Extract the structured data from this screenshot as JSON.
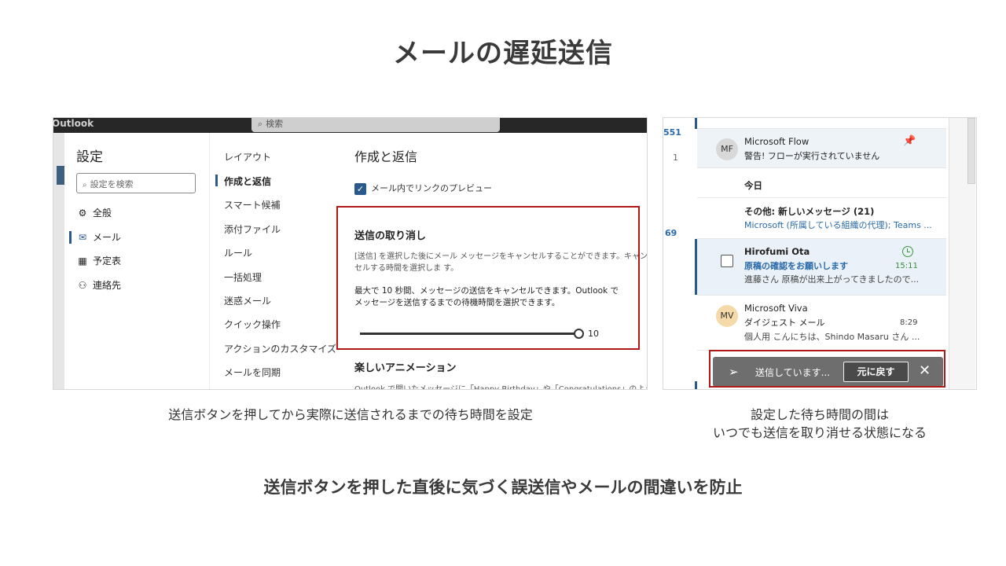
{
  "slide": {
    "title": "メールの遅延送信",
    "caption_left": "送信ボタンを押してから実際に送信されるまでの待ち時間を設定",
    "caption_right_line1": "設定した待ち時間の間は",
    "caption_right_line2": "いつでも送信を取り消せる状態になる",
    "bottom_message": "送信ボタンを押した直後に気づく誤送信やメールの間違いを防止"
  },
  "colors": {
    "accent": "#2a5a8c",
    "highlight": "#b01818",
    "topbar": "#272727"
  },
  "outlook_settings": {
    "app_name": "Outlook",
    "search_placeholder": "検索",
    "settings_title": "設定",
    "settings_search": "設定を検索",
    "nav": [
      {
        "label": "全般",
        "icon": "gear-icon"
      },
      {
        "label": "メール",
        "icon": "mail-icon"
      },
      {
        "label": "予定表",
        "icon": "calendar-icon"
      },
      {
        "label": "連絡先",
        "icon": "people-icon"
      }
    ],
    "subnav": [
      "レイアウト",
      "作成と返信",
      "スマート候補",
      "添付ファイル",
      "ルール",
      "一括処理",
      "迷惑メール",
      "クイック操作",
      "アクションのカスタマイズ",
      "メールを同期"
    ],
    "content_title": "作成と返信",
    "link_preview_label": "メール内でリンクのプレビュー",
    "undo_send_title": "送信の取り消し",
    "undo_send_desc": "[送信] を選択した後にメール メッセージをキャンセルすることができます。キャンセルする時間を選択しま す。",
    "undo_send_detail": "最大で 10 秒間、メッセージの送信をキャンセルできます。Outlook でメッセージを送信するまでの待機時間を選択できます。",
    "slider_value": "10",
    "slider_fraction": 1.0,
    "animation_title": "楽しいアニメーション",
    "animation_desc": "Outlook で開いたメッセージに「Happy Birthday」や「Congratulations」のような"
  },
  "mail_list": {
    "counts": [
      "551",
      "1",
      "69"
    ],
    "rows": [
      {
        "avatar": "MF",
        "sender": "Microsoft Flow",
        "subject": "警告! フローが実行されていません"
      },
      {
        "label": "今日"
      },
      {
        "sender": "その他: 新しいメッセージ (21)",
        "preview": "Microsoft (所属している組織の代理); Teams ..."
      },
      {
        "sender": "Hirofumi Ota",
        "subject": "原稿の確認をお願いします",
        "time": "15:11",
        "preview": "進藤さん 原稿が出来上がってきましたので..."
      },
      {
        "avatar": "MV",
        "sender": "Microsoft Viva",
        "subject": "ダイジェスト メール",
        "time": "8:29",
        "preview": "個人用 こんにちは、Shindo Masaru さん ..."
      }
    ],
    "toast": {
      "message": "送信しています...",
      "undo_label": "元に戻す"
    }
  }
}
